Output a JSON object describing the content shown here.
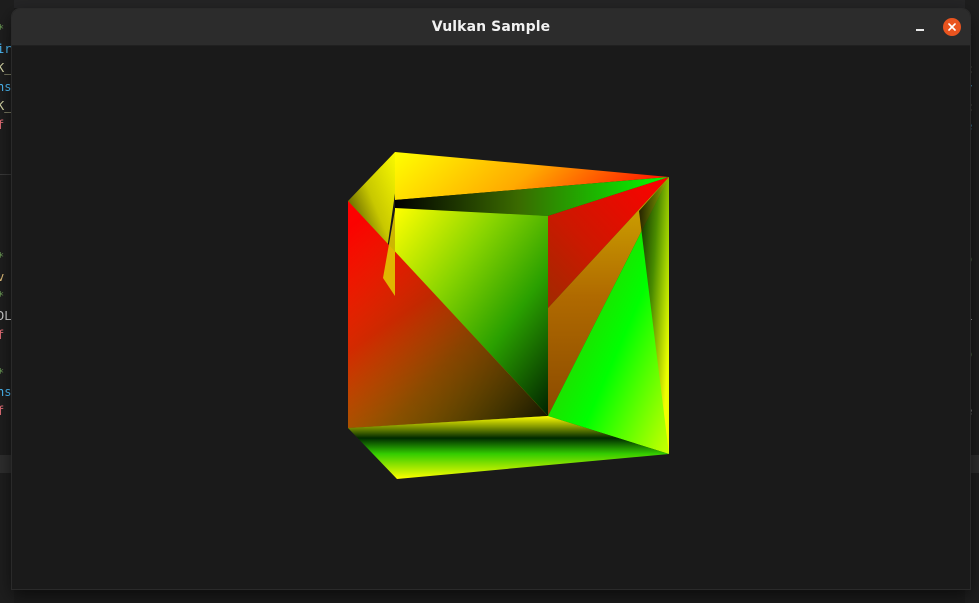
{
  "window": {
    "title": "Vulkan Sample"
  },
  "controls": {
    "minimize_icon": "minimize-icon",
    "close_icon": "close-icon"
  },
  "colors": {
    "titlebar": "#2c2c2c",
    "close_button": "#e9541f",
    "viewport_background": "#1a1a1a",
    "cube_red": "#ff0000",
    "cube_green": "#00ff00",
    "cube_yellow": "#ffff00",
    "cube_black": "#000000"
  },
  "background_editor": {
    "left_fragments": [
      "*",
      "ir",
      "K_",
      "ns",
      "K_",
      "f",
      "*",
      "v",
      "*",
      "DL",
      "f",
      "*",
      "ns",
      "f"
    ],
    "right_fragments": [
      "l",
      "c",
      "r",
      "c",
      "e",
      "o",
      "L",
      "o",
      "e"
    ]
  }
}
